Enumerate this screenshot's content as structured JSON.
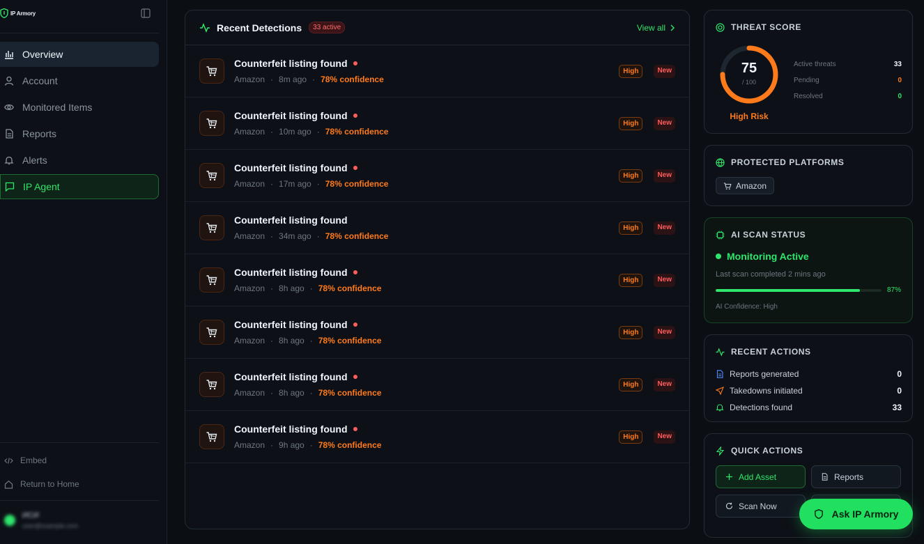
{
  "brand": {
    "name": "IP Armory"
  },
  "sidebar": {
    "items": [
      {
        "label": "Overview",
        "icon": "bar-chart-icon"
      },
      {
        "label": "Account",
        "icon": "user-icon"
      },
      {
        "label": "Monitored Items",
        "icon": "eye-icon"
      },
      {
        "label": "Reports",
        "icon": "document-icon"
      },
      {
        "label": "Alerts",
        "icon": "bell-icon"
      },
      {
        "label": "IP Agent",
        "icon": "chat-icon"
      }
    ],
    "bottom": [
      {
        "label": "Embed",
        "icon": "code-icon"
      },
      {
        "label": "Return to Home",
        "icon": "home-icon"
      }
    ],
    "user": {
      "name": "ИСИ",
      "email": "user@example.com"
    }
  },
  "detections": {
    "title": "Recent Detections",
    "active_badge": "33 active",
    "view_all": "View all",
    "rows": [
      {
        "title": "Counterfeit listing found",
        "unread": true,
        "platform": "Amazon",
        "time": "8m ago",
        "confidence": "78% confidence",
        "severity": "High",
        "status": "New"
      },
      {
        "title": "Counterfeit listing found",
        "unread": true,
        "platform": "Amazon",
        "time": "10m ago",
        "confidence": "78% confidence",
        "severity": "High",
        "status": "New"
      },
      {
        "title": "Counterfeit listing found",
        "unread": true,
        "platform": "Amazon",
        "time": "17m ago",
        "confidence": "78% confidence",
        "severity": "High",
        "status": "New"
      },
      {
        "title": "Counterfeit listing found",
        "unread": false,
        "platform": "Amazon",
        "time": "34m ago",
        "confidence": "78% confidence",
        "severity": "High",
        "status": "New"
      },
      {
        "title": "Counterfeit listing found",
        "unread": true,
        "platform": "Amazon",
        "time": "8h ago",
        "confidence": "78% confidence",
        "severity": "High",
        "status": "New"
      },
      {
        "title": "Counterfeit listing found",
        "unread": true,
        "platform": "Amazon",
        "time": "8h ago",
        "confidence": "78% confidence",
        "severity": "High",
        "status": "New"
      },
      {
        "title": "Counterfeit listing found",
        "unread": true,
        "platform": "Amazon",
        "time": "8h ago",
        "confidence": "78% confidence",
        "severity": "High",
        "status": "New"
      },
      {
        "title": "Counterfeit listing found",
        "unread": true,
        "platform": "Amazon",
        "time": "9h ago",
        "confidence": "78% confidence",
        "severity": "High",
        "status": "New"
      }
    ]
  },
  "threat": {
    "title": "THREAT SCORE",
    "score": "75",
    "score_fraction": 0.75,
    "max": "/ 100",
    "risk": "High Risk",
    "stats": [
      {
        "label": "Active threats",
        "value": "33"
      },
      {
        "label": "Pending",
        "value": "0"
      },
      {
        "label": "Resolved",
        "value": "0"
      }
    ]
  },
  "platforms": {
    "title": "PROTECTED PLATFORMS",
    "items": [
      "Amazon"
    ]
  },
  "scan": {
    "title": "AI SCAN STATUS",
    "status": "Monitoring Active",
    "last_scan": "Last scan completed 2 mins ago",
    "progress": 0.87,
    "progress_label": "87%",
    "confidence": "AI Confidence: High"
  },
  "recent_actions": {
    "title": "RECENT ACTIONS",
    "items": [
      {
        "label": "Reports generated",
        "value": "0",
        "icon": "document-icon"
      },
      {
        "label": "Takedowns initiated",
        "value": "0",
        "icon": "send-icon"
      },
      {
        "label": "Detections found",
        "value": "33",
        "icon": "bell-icon"
      }
    ]
  },
  "quick_actions": {
    "title": "QUICK ACTIONS",
    "buttons": [
      {
        "label": "Add Asset",
        "icon": "plus-icon"
      },
      {
        "label": "Reports",
        "icon": "document-icon"
      },
      {
        "label": "Scan Now",
        "icon": "refresh-icon"
      }
    ]
  },
  "ask": {
    "label": "Ask IP Armory"
  },
  "colors": {
    "accent": "#2ee66b",
    "warning": "#ff7a1a",
    "danger": "#ff5c5c",
    "background": "#0b0f14"
  }
}
